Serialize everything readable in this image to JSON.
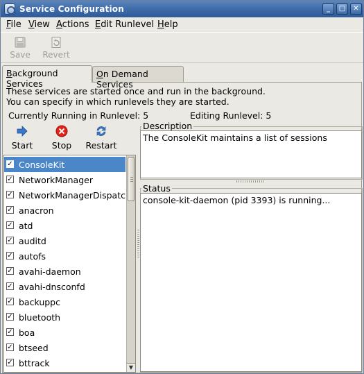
{
  "window": {
    "title": "Service Configuration",
    "controls": [
      "_",
      "□",
      "✕"
    ]
  },
  "menubar": [
    {
      "label": "File",
      "mnemonic": "F",
      "rest": "ile"
    },
    {
      "label": "View",
      "mnemonic": "V",
      "rest": "iew"
    },
    {
      "label": "Actions",
      "mnemonic": "A",
      "rest": "ctions"
    },
    {
      "label": "Edit Runlevel",
      "mnemonic": "E",
      "rest": "dit Runlevel"
    },
    {
      "label": "Help",
      "mnemonic": "H",
      "rest": "elp"
    }
  ],
  "toolbar": {
    "save_label": "Save",
    "revert_label": "Revert"
  },
  "tabs": [
    {
      "mnemonic": "B",
      "rest": "ackground Services",
      "active": true
    },
    {
      "mnemonic": "O",
      "rest": "n Demand Services",
      "active": false
    }
  ],
  "info": {
    "line1": "These services are started once and run in the background.",
    "line2": "You can specify in which runlevels they are started.",
    "current_runlevel": "Currently Running in Runlevel: 5",
    "editing_runlevel": "Editing Runlevel: 5"
  },
  "actions": {
    "start_label": "Start",
    "stop_label": "Stop",
    "restart_label": "Restart"
  },
  "services": [
    {
      "name": "ConsoleKit",
      "checked": true,
      "selected": true
    },
    {
      "name": "NetworkManager",
      "checked": true
    },
    {
      "name": "NetworkManagerDispatcher",
      "checked": true
    },
    {
      "name": "anacron",
      "checked": true
    },
    {
      "name": "atd",
      "checked": true
    },
    {
      "name": "auditd",
      "checked": true
    },
    {
      "name": "autofs",
      "checked": true
    },
    {
      "name": "avahi-daemon",
      "checked": true
    },
    {
      "name": "avahi-dnsconfd",
      "checked": true
    },
    {
      "name": "backuppc",
      "checked": true
    },
    {
      "name": "bluetooth",
      "checked": true
    },
    {
      "name": "boa",
      "checked": true
    },
    {
      "name": "btseed",
      "checked": true
    },
    {
      "name": "bttrack",
      "checked": true
    }
  ],
  "description": {
    "label": "Description",
    "text": "The ConsoleKit maintains a list of sessions"
  },
  "status": {
    "label": "Status",
    "text": "console-kit-daemon (pid 3393) is running..."
  },
  "colors": {
    "selection": "#4b86c8",
    "titlebar": "#3c69a8"
  }
}
